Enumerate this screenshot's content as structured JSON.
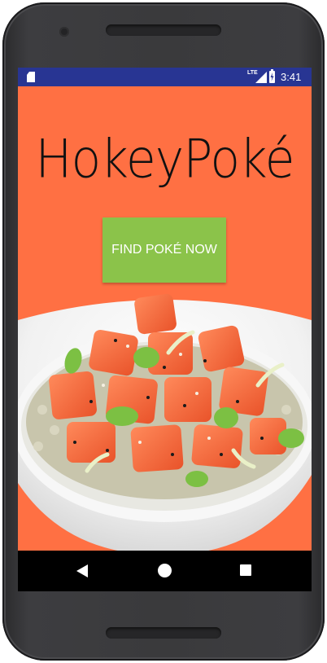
{
  "status_bar": {
    "time": "3:41",
    "network": "LTE",
    "icons": [
      "sim-card-icon",
      "lte-signal-icon",
      "battery-charging-icon"
    ]
  },
  "app": {
    "logo_text": "HokeyPoké",
    "find_button_label": "FIND POKÉ NOW",
    "hero_image": "poke-bowl-image"
  },
  "nav_bar": {
    "icons": [
      "back-icon",
      "home-icon",
      "recents-icon"
    ]
  },
  "colors": {
    "screen_background": "#ff7043",
    "status_bar": "#283593",
    "button": "#8bc34a",
    "nav_bar": "#000000"
  }
}
